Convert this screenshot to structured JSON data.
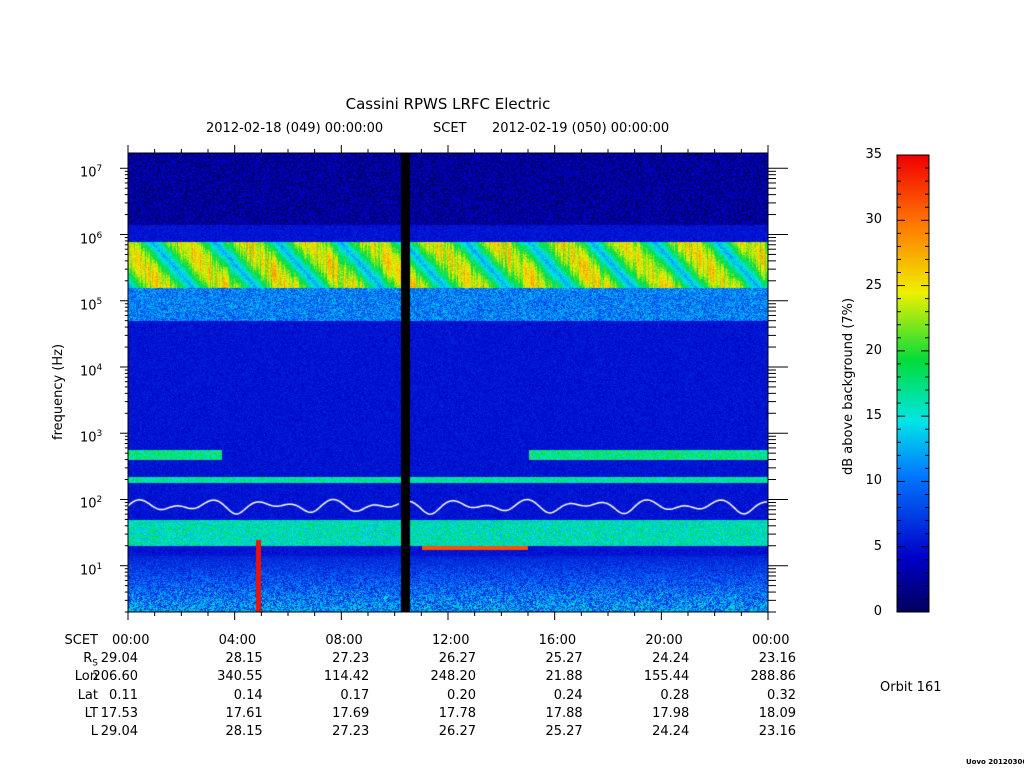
{
  "chart_data": {
    "type": "heatmap",
    "title": "Cassini RPWS LRFC Electric",
    "subtitle": {
      "start": "2012-02-18 (049) 00:00:00",
      "middle": "SCET",
      "end": "2012-02-19 (050) 00:00:00"
    },
    "ylabel": "frequency (Hz)",
    "yscale": "log",
    "ylim": [
      2,
      17000000
    ],
    "ytick_labels": [
      {
        "base": "10",
        "exp": "7",
        "value": 10000000
      },
      {
        "base": "10",
        "exp": "6",
        "value": 1000000
      },
      {
        "base": "10",
        "exp": "5",
        "value": 100000
      },
      {
        "base": "10",
        "exp": "4",
        "value": 10000
      },
      {
        "base": "10",
        "exp": "3",
        "value": 1000
      },
      {
        "base": "10",
        "exp": "2",
        "value": 100
      },
      {
        "base": "10",
        "exp": "1",
        "value": 10
      }
    ],
    "xlim_hours": [
      0,
      24
    ],
    "colorbar": {
      "label": "dB above background (7%)",
      "range": [
        0,
        35
      ],
      "ticks": [
        "0",
        "5",
        "10",
        "15",
        "20",
        "25",
        "30",
        "35"
      ]
    },
    "data_gaps_hours": [
      [
        10.2,
        10.55
      ]
    ],
    "overlay_line": {
      "color": "#ffffff",
      "approx_frequency_hz": [
        60,
        100
      ]
    },
    "ephemeris": {
      "row_labels": [
        "SCET",
        "R",
        "Lon",
        "Lat",
        "LT",
        "L"
      ],
      "rs_subscript": "S",
      "columns": [
        {
          "SCET": "00:00",
          "R": "29.04",
          "Lon": "206.60",
          "Lat": "0.11",
          "LT": "17.53",
          "L": "29.04"
        },
        {
          "SCET": "04:00",
          "R": "28.15",
          "Lon": "340.55",
          "Lat": "0.14",
          "LT": "17.61",
          "L": "28.15"
        },
        {
          "SCET": "08:00",
          "R": "27.23",
          "Lon": "114.42",
          "Lat": "0.17",
          "LT": "17.69",
          "L": "27.23"
        },
        {
          "SCET": "12:00",
          "R": "26.27",
          "Lon": "248.20",
          "Lat": "0.20",
          "LT": "17.78",
          "L": "26.27"
        },
        {
          "SCET": "16:00",
          "R": "25.27",
          "Lon": "21.88",
          "Lat": "0.24",
          "LT": "17.88",
          "L": "25.27"
        },
        {
          "SCET": "20:00",
          "R": "24.24",
          "Lon": "155.44",
          "Lat": "0.28",
          "LT": "17.98",
          "L": "24.24"
        },
        {
          "SCET": "00:00",
          "R": "23.16",
          "Lon": "288.86",
          "Lat": "0.32",
          "LT": "18.09",
          "L": "23.16"
        }
      ]
    },
    "orbit": "Orbit 161",
    "footer": "Uovo 20120306"
  }
}
